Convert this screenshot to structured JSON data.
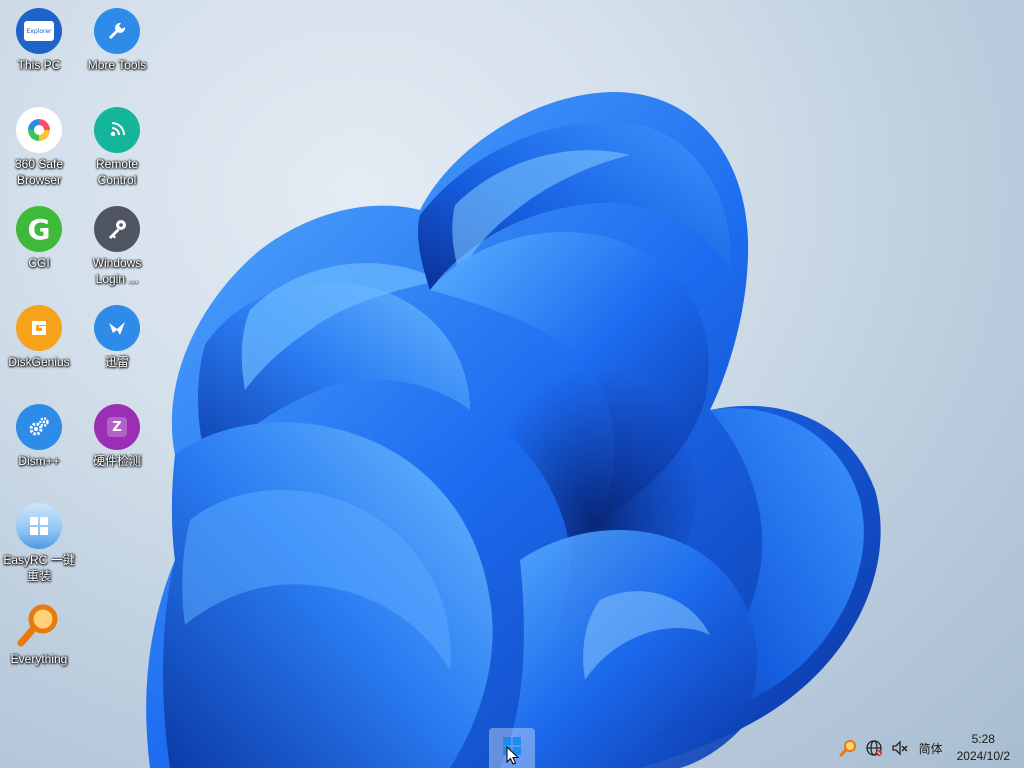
{
  "desktop": {
    "icons": [
      {
        "label": "This PC",
        "icon": "explorer-icon"
      },
      {
        "label": "More Tools",
        "icon": "wrench-icon"
      },
      {
        "label": "360 Safe\nBrowser",
        "icon": "browser-360-icon"
      },
      {
        "label": "Remote\nControl",
        "icon": "remote-control-icon"
      },
      {
        "label": "CGI",
        "icon": "cgi-icon"
      },
      {
        "label": "Windows\nLogin ...",
        "icon": "key-icon"
      },
      {
        "label": "DiskGenius",
        "icon": "diskgenius-icon"
      },
      {
        "label": "迅雷",
        "icon": "thunder-icon"
      },
      {
        "label": "Dism++",
        "icon": "gears-icon"
      },
      {
        "label": "硬件检测",
        "icon": "hardware-check-icon"
      },
      {
        "label": "EasyRC 一键\n重装",
        "icon": "windows-logo-icon"
      },
      {
        "label": "Everything",
        "icon": "magnifier-icon"
      }
    ],
    "explorer_badge": "Explorer",
    "cgi_letter": "G",
    "hardware_letter": "Z"
  },
  "taskbar": {
    "start_icon": "windows-start-icon",
    "tray": {
      "icons": [
        "everything-search-icon",
        "network-globe-icon",
        "volume-muted-icon"
      ],
      "ime": "简体",
      "time": "5:28",
      "date": "2024/10/2"
    }
  },
  "colors": {
    "bloom_primary": "#1f6ff0",
    "bloom_dark": "#0b3fb8",
    "bloom_light": "#4aa0ff",
    "accent_blue": "#2f8be8"
  }
}
